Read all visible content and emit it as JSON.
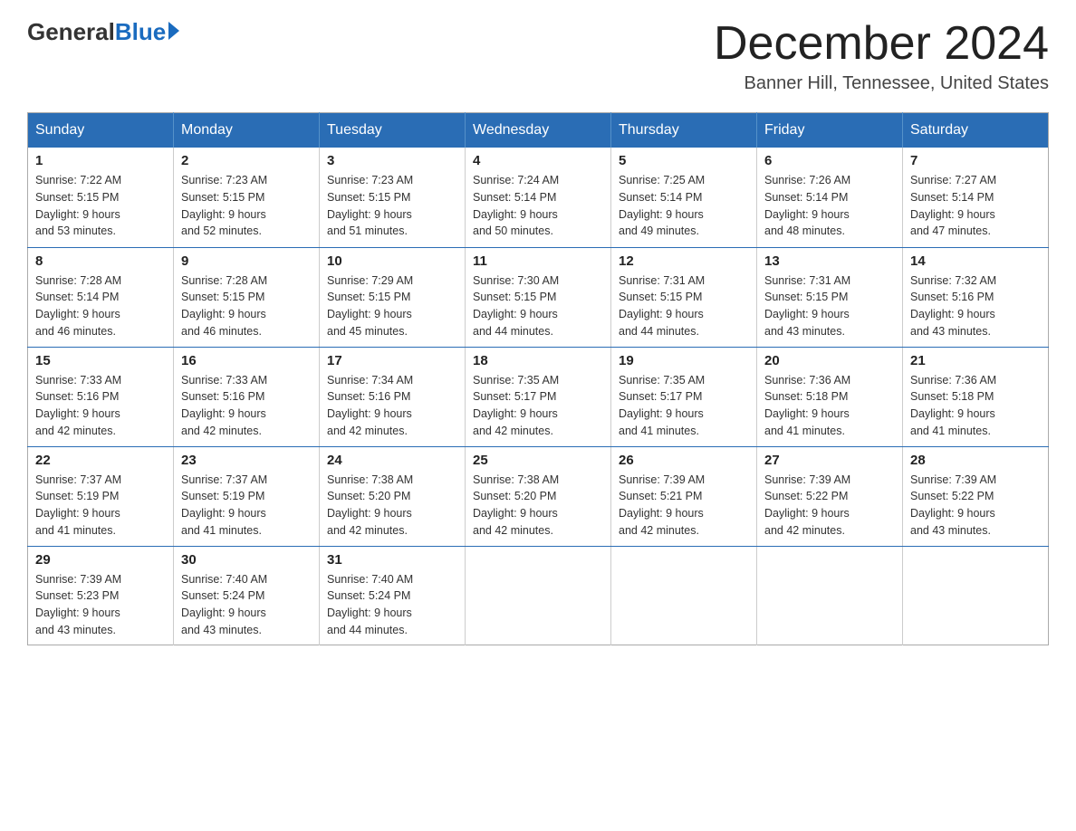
{
  "header": {
    "logo_general": "General",
    "logo_blue": "Blue",
    "month_title": "December 2024",
    "location": "Banner Hill, Tennessee, United States"
  },
  "days_of_week": [
    "Sunday",
    "Monday",
    "Tuesday",
    "Wednesday",
    "Thursday",
    "Friday",
    "Saturday"
  ],
  "weeks": [
    [
      {
        "day": "1",
        "sunrise": "7:22 AM",
        "sunset": "5:15 PM",
        "daylight": "9 hours and 53 minutes."
      },
      {
        "day": "2",
        "sunrise": "7:23 AM",
        "sunset": "5:15 PM",
        "daylight": "9 hours and 52 minutes."
      },
      {
        "day": "3",
        "sunrise": "7:23 AM",
        "sunset": "5:15 PM",
        "daylight": "9 hours and 51 minutes."
      },
      {
        "day": "4",
        "sunrise": "7:24 AM",
        "sunset": "5:14 PM",
        "daylight": "9 hours and 50 minutes."
      },
      {
        "day": "5",
        "sunrise": "7:25 AM",
        "sunset": "5:14 PM",
        "daylight": "9 hours and 49 minutes."
      },
      {
        "day": "6",
        "sunrise": "7:26 AM",
        "sunset": "5:14 PM",
        "daylight": "9 hours and 48 minutes."
      },
      {
        "day": "7",
        "sunrise": "7:27 AM",
        "sunset": "5:14 PM",
        "daylight": "9 hours and 47 minutes."
      }
    ],
    [
      {
        "day": "8",
        "sunrise": "7:28 AM",
        "sunset": "5:14 PM",
        "daylight": "9 hours and 46 minutes."
      },
      {
        "day": "9",
        "sunrise": "7:28 AM",
        "sunset": "5:15 PM",
        "daylight": "9 hours and 46 minutes."
      },
      {
        "day": "10",
        "sunrise": "7:29 AM",
        "sunset": "5:15 PM",
        "daylight": "9 hours and 45 minutes."
      },
      {
        "day": "11",
        "sunrise": "7:30 AM",
        "sunset": "5:15 PM",
        "daylight": "9 hours and 44 minutes."
      },
      {
        "day": "12",
        "sunrise": "7:31 AM",
        "sunset": "5:15 PM",
        "daylight": "9 hours and 44 minutes."
      },
      {
        "day": "13",
        "sunrise": "7:31 AM",
        "sunset": "5:15 PM",
        "daylight": "9 hours and 43 minutes."
      },
      {
        "day": "14",
        "sunrise": "7:32 AM",
        "sunset": "5:16 PM",
        "daylight": "9 hours and 43 minutes."
      }
    ],
    [
      {
        "day": "15",
        "sunrise": "7:33 AM",
        "sunset": "5:16 PM",
        "daylight": "9 hours and 42 minutes."
      },
      {
        "day": "16",
        "sunrise": "7:33 AM",
        "sunset": "5:16 PM",
        "daylight": "9 hours and 42 minutes."
      },
      {
        "day": "17",
        "sunrise": "7:34 AM",
        "sunset": "5:16 PM",
        "daylight": "9 hours and 42 minutes."
      },
      {
        "day": "18",
        "sunrise": "7:35 AM",
        "sunset": "5:17 PM",
        "daylight": "9 hours and 42 minutes."
      },
      {
        "day": "19",
        "sunrise": "7:35 AM",
        "sunset": "5:17 PM",
        "daylight": "9 hours and 41 minutes."
      },
      {
        "day": "20",
        "sunrise": "7:36 AM",
        "sunset": "5:18 PM",
        "daylight": "9 hours and 41 minutes."
      },
      {
        "day": "21",
        "sunrise": "7:36 AM",
        "sunset": "5:18 PM",
        "daylight": "9 hours and 41 minutes."
      }
    ],
    [
      {
        "day": "22",
        "sunrise": "7:37 AM",
        "sunset": "5:19 PM",
        "daylight": "9 hours and 41 minutes."
      },
      {
        "day": "23",
        "sunrise": "7:37 AM",
        "sunset": "5:19 PM",
        "daylight": "9 hours and 41 minutes."
      },
      {
        "day": "24",
        "sunrise": "7:38 AM",
        "sunset": "5:20 PM",
        "daylight": "9 hours and 42 minutes."
      },
      {
        "day": "25",
        "sunrise": "7:38 AM",
        "sunset": "5:20 PM",
        "daylight": "9 hours and 42 minutes."
      },
      {
        "day": "26",
        "sunrise": "7:39 AM",
        "sunset": "5:21 PM",
        "daylight": "9 hours and 42 minutes."
      },
      {
        "day": "27",
        "sunrise": "7:39 AM",
        "sunset": "5:22 PM",
        "daylight": "9 hours and 42 minutes."
      },
      {
        "day": "28",
        "sunrise": "7:39 AM",
        "sunset": "5:22 PM",
        "daylight": "9 hours and 43 minutes."
      }
    ],
    [
      {
        "day": "29",
        "sunrise": "7:39 AM",
        "sunset": "5:23 PM",
        "daylight": "9 hours and 43 minutes."
      },
      {
        "day": "30",
        "sunrise": "7:40 AM",
        "sunset": "5:24 PM",
        "daylight": "9 hours and 43 minutes."
      },
      {
        "day": "31",
        "sunrise": "7:40 AM",
        "sunset": "5:24 PM",
        "daylight": "9 hours and 44 minutes."
      },
      null,
      null,
      null,
      null
    ]
  ],
  "labels": {
    "sunrise": "Sunrise:",
    "sunset": "Sunset:",
    "daylight": "Daylight:"
  }
}
